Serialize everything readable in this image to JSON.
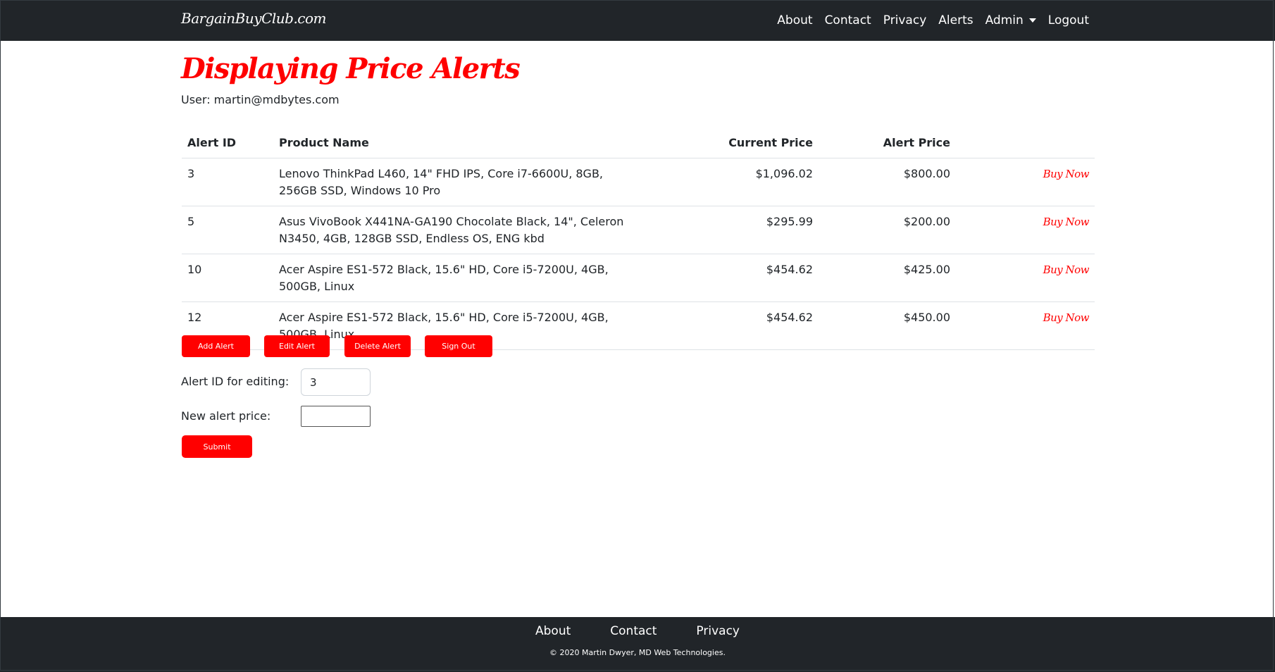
{
  "navbar": {
    "brand": "BargainBuyClub.com",
    "links": {
      "about": "About",
      "contact": "Contact",
      "privacy": "Privacy",
      "alerts": "Alerts",
      "admin": "Admin",
      "logout": "Logout"
    }
  },
  "page": {
    "title": "Displaying Price Alerts",
    "user_line": "User: martin@mdbytes.com"
  },
  "table": {
    "headers": {
      "alert_id": "Alert ID",
      "product_name": "Product Name",
      "current_price": "Current Price",
      "alert_price": "Alert Price"
    },
    "rows": [
      {
        "alert_id": "3",
        "product_name": "Lenovo ThinkPad L460, 14\" FHD IPS, Core i7-6600U, 8GB, 256GB SSD, Windows 10 Pro",
        "current_price": "$1,096.02",
        "alert_price": "$800.00",
        "action": "Buy Now"
      },
      {
        "alert_id": "5",
        "product_name": "Asus VivoBook X441NA-GA190 Chocolate Black, 14\", Celeron N3450, 4GB, 128GB SSD, Endless OS, ENG kbd",
        "current_price": "$295.99",
        "alert_price": "$200.00",
        "action": "Buy Now"
      },
      {
        "alert_id": "10",
        "product_name": "Acer Aspire ES1-572 Black, 15.6\" HD, Core i5-7200U, 4GB, 500GB, Linux",
        "current_price": "$454.62",
        "alert_price": "$425.00",
        "action": "Buy Now"
      },
      {
        "alert_id": "12",
        "product_name": "Acer Aspire ES1-572 Black, 15.6\" HD, Core i5-7200U, 4GB, 500GB, Linux",
        "current_price": "$454.62",
        "alert_price": "$450.00",
        "action": "Buy Now"
      }
    ]
  },
  "actions": {
    "add_alert": "Add Alert",
    "edit_alert": "Edit Alert",
    "delete_alert": "Delete Alert",
    "sign_out": "Sign Out"
  },
  "form": {
    "alert_id_label": "Alert ID for editing:",
    "alert_id_value": "3",
    "new_price_label": "New alert price:",
    "new_price_value": "",
    "submit_label": "Submit"
  },
  "footer": {
    "links": {
      "about": "About",
      "contact": "Contact",
      "privacy": "Privacy"
    },
    "copyright": "© 2020 Martin Dwyer, MD Web Technologies."
  },
  "colors": {
    "accent": "#ff0000",
    "navbar_bg": "#212529",
    "text": "#212529"
  }
}
